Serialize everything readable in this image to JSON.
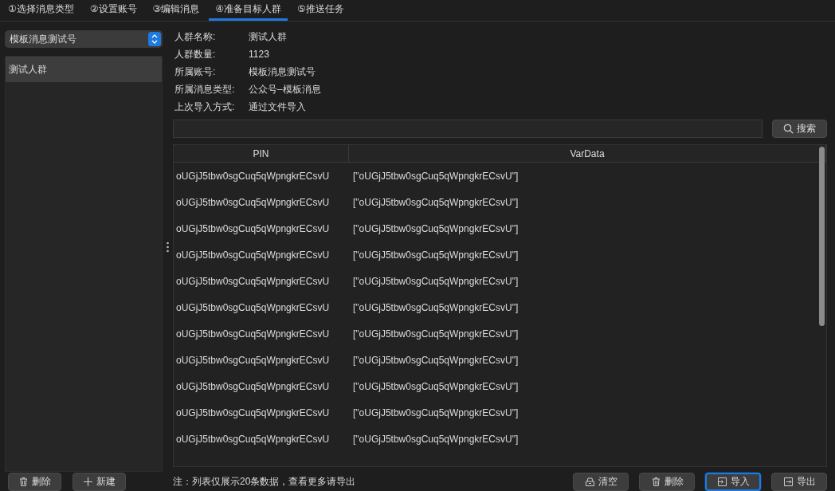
{
  "tabs": [
    {
      "label": "①选择消息类型",
      "selected": false
    },
    {
      "label": "②设置账号",
      "selected": false
    },
    {
      "label": "③编辑消息",
      "selected": false
    },
    {
      "label": "④准备目标人群",
      "selected": true
    },
    {
      "label": "⑤推送任务",
      "selected": false
    }
  ],
  "sidebar": {
    "account_select": {
      "value": "模板消息测试号"
    },
    "groups": [
      {
        "label": "测试人群",
        "selected": true
      }
    ],
    "buttons": [
      {
        "label": "删除",
        "kind": "trash"
      },
      {
        "label": "新建",
        "kind": "plus"
      }
    ]
  },
  "details": [
    {
      "label": "人群名称:",
      "value": "测试人群"
    },
    {
      "label": "人群数量:",
      "value": "1123"
    },
    {
      "label": "所属账号:",
      "value": "模板消息测试号"
    },
    {
      "label": "所属消息类型:",
      "value": "公众号–模板消息"
    },
    {
      "label": "上次导入方式:",
      "value": "通过文件导入"
    }
  ],
  "search": {
    "button": "搜索"
  },
  "table": {
    "columns": [
      "PIN",
      "VarData"
    ],
    "rows": [
      [
        "oUGjJ5tbw0sgCuq5qWpngkrECsvU",
        "[\"oUGjJ5tbw0sgCuq5qWpngkrECsvU\"]"
      ],
      [
        "oUGjJ5tbw0sgCuq5qWpngkrECsvU",
        "[\"oUGjJ5tbw0sgCuq5qWpngkrECsvU\"]"
      ],
      [
        "oUGjJ5tbw0sgCuq5qWpngkrECsvU",
        "[\"oUGjJ5tbw0sgCuq5qWpngkrECsvU\"]"
      ],
      [
        "oUGjJ5tbw0sgCuq5qWpngkrECsvU",
        "[\"oUGjJ5tbw0sgCuq5qWpngkrECsvU\"]"
      ],
      [
        "oUGjJ5tbw0sgCuq5qWpngkrECsvU",
        "[\"oUGjJ5tbw0sgCuq5qWpngkrECsvU\"]"
      ],
      [
        "oUGjJ5tbw0sgCuq5qWpngkrECsvU",
        "[\"oUGjJ5tbw0sgCuq5qWpngkrECsvU\"]"
      ],
      [
        "oUGjJ5tbw0sgCuq5qWpngkrECsvU",
        "[\"oUGjJ5tbw0sgCuq5qWpngkrECsvU\"]"
      ],
      [
        "oUGjJ5tbw0sgCuq5qWpngkrECsvU",
        "[\"oUGjJ5tbw0sgCuq5qWpngkrECsvU\"]"
      ],
      [
        "oUGjJ5tbw0sgCuq5qWpngkrECsvU",
        "[\"oUGjJ5tbw0sgCuq5qWpngkrECsvU\"]"
      ],
      [
        "oUGjJ5tbw0sgCuq5qWpngkrECsvU",
        "[\"oUGjJ5tbw0sgCuq5qWpngkrECsvU\"]"
      ],
      [
        "oUGjJ5tbw0sgCuq5qWpngkrECsvU",
        "[\"oUGjJ5tbw0sgCuq5qWpngkrECsvU\"]"
      ]
    ]
  },
  "footer": {
    "note": "注：列表仅展示20条数据，查看更多请导出",
    "buttons": [
      {
        "label": "清空",
        "kind": "clear",
        "focused": false
      },
      {
        "label": "删除",
        "kind": "trash",
        "focused": false
      },
      {
        "label": "导入",
        "kind": "import",
        "focused": true
      },
      {
        "label": "导出",
        "kind": "export",
        "focused": false
      }
    ]
  }
}
